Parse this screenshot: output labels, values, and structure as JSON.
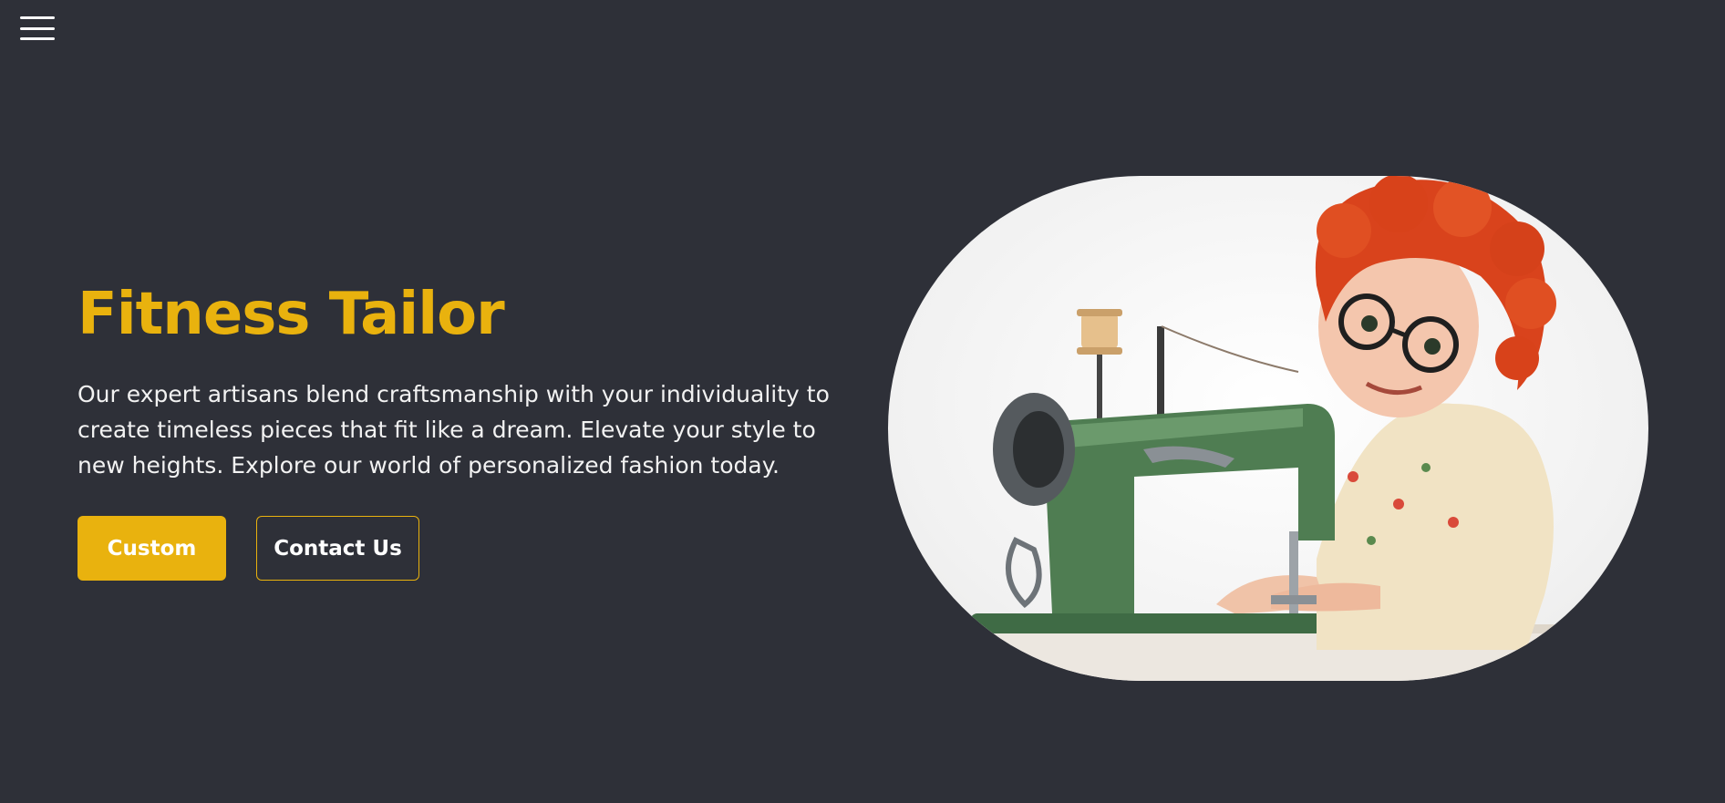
{
  "nav": {
    "menu_icon": "hamburger-menu-icon"
  },
  "hero": {
    "title": "Fitness Tailor",
    "description": "Our expert artisans blend craftsmanship with your individuality to create timeless pieces that fit like a dream. Elevate your style to new heights. Explore our world of personalized fashion today.",
    "primary_button": "Custom",
    "secondary_button": "Contact Us"
  },
  "colors": {
    "background": "#2e3038",
    "accent": "#e9b20e",
    "text": "#ffffff"
  }
}
